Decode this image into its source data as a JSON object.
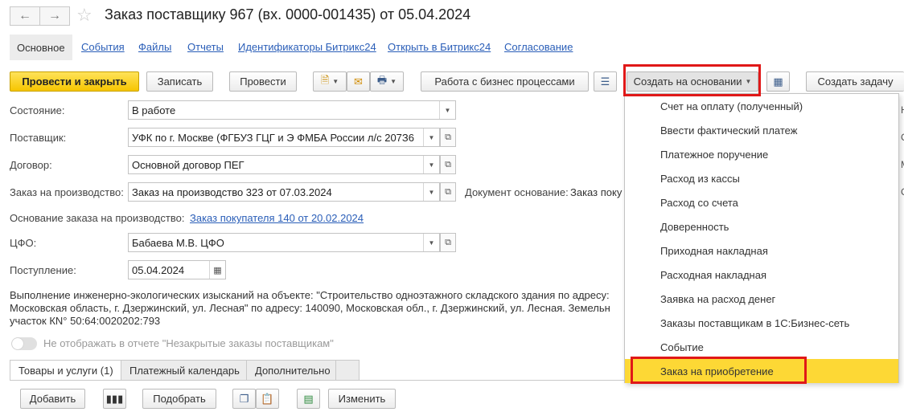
{
  "window": {
    "title": "Заказ поставщику 967 (вх. 0000-001435) от 05.04.2024",
    "back_icon": "arrow-left",
    "forward_icon": "arrow-right",
    "star_icon": "star-outline"
  },
  "tabs": {
    "active": "Основное",
    "links": [
      "События",
      "Файлы",
      "Отчеты",
      "Идентификаторы Битрикс24",
      "Открыть в Битрикс24",
      "Согласование"
    ]
  },
  "toolbar": {
    "post_close": "Провести и закрыть",
    "save": "Записать",
    "post": "Провести",
    "business_processes": "Работа с бизнес процессами",
    "create_based": "Создать на основании",
    "create_task": "Создать задачу"
  },
  "form": {
    "status_label": "Состояние:",
    "status_value": "В работе",
    "supplier_label": "Поставщик:",
    "supplier_value": "УФК по г. Москве (ФГБУЗ ГЦГ и Э ФМБА России л/с 207З6",
    "contract_label": "Договор:",
    "contract_value": "Основной договор ПЕГ",
    "production_order_label": "Заказ на производство:",
    "production_order_value": "Заказ на производство 323 от 07.03.2024",
    "base_document_label": "Документ основание:",
    "base_document_value": "Заказ поку",
    "production_basis_label": "Основание заказа на производство:",
    "production_basis_link": "Заказ покупателя 140 от 20.02.2024",
    "cfo_label": "ЦФО:",
    "cfo_value": "Бабаева М.В. ЦФО",
    "receipt_label": "Поступление:",
    "receipt_value": "05.04.2024",
    "description_lines": [
      "Выполнение инженерно-экологических изысканий на объекте: \"Строительство одноэтажного складского здания по адресу:",
      "Московская область, г. Дзержинский, ул. Лесная\" по адресу: 140090, Московская обл., г. Дзержинский, ул. Лесная. Земельн",
      "участок КN° 50:64:0020202:793"
    ],
    "toggle_label": "Не отображать в отчете \"Незакрытые заказы поставщикам\""
  },
  "bottom_tabs": [
    "Товары и услуги (1)",
    "Платежный календарь",
    "Дополнительно"
  ],
  "bottom_toolbar": {
    "add": "Добавить",
    "pick": "Подобрать",
    "change": "Изменить"
  },
  "menu": {
    "items": [
      "Счет на оплату (полученный)",
      "Ввести фактический платеж",
      "Платежное поручение",
      "Расход из кассы",
      "Расход со счета",
      "Доверенность",
      "Приходная накладная",
      "Расходная накладная",
      "Заявка на расход денег",
      "Заказы поставщикам в 1С:Бизнес-сеть",
      "Событие",
      "Заказ на приобретение"
    ],
    "highlighted_index": 11
  },
  "right_edge_letters": [
    "Н",
    "С",
    "М",
    "С"
  ],
  "colors": {
    "primary_button": "#f6c500",
    "menu_highlight": "#fdd835",
    "annotation_red": "#e01818",
    "link": "#2a5eb8"
  }
}
